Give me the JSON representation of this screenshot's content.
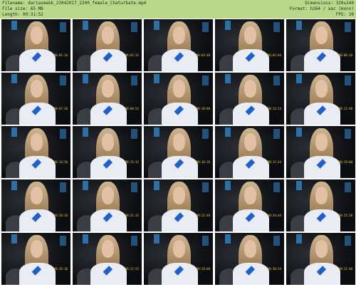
{
  "header": {
    "filename": "Filename: dariasmekk_23042017_2200_female_Chaturbate.mp4",
    "filesize": "File size: 65 MB",
    "length": "Length: 00:31:52",
    "dimensions": "Dimensions: 320x240",
    "format": "Format: h264 / aac (mono)",
    "fps": "FPS: 30"
  },
  "header_color": "#b9d98a",
  "thumbnails": [
    {
      "ts": "00:01:16"
    },
    {
      "ts": "00:02:32"
    },
    {
      "ts": "00:03:48"
    },
    {
      "ts": "00:05:04"
    },
    {
      "ts": "00:06:20"
    },
    {
      "ts": "00:07:36"
    },
    {
      "ts": "00:08:52"
    },
    {
      "ts": "00:10:08"
    },
    {
      "ts": "00:11:24"
    },
    {
      "ts": "00:12:40"
    },
    {
      "ts": "00:13:56"
    },
    {
      "ts": "00:15:12"
    },
    {
      "ts": "00:16:28"
    },
    {
      "ts": "00:17:44"
    },
    {
      "ts": "00:19:00"
    },
    {
      "ts": "00:20:16"
    },
    {
      "ts": "00:21:32"
    },
    {
      "ts": "00:22:48"
    },
    {
      "ts": "00:24:04"
    },
    {
      "ts": "00:25:20"
    },
    {
      "ts": "00:26:36"
    },
    {
      "ts": "00:27:52"
    },
    {
      "ts": "00:29:08"
    },
    {
      "ts": "00:30:24"
    },
    {
      "ts": "00:31:40"
    }
  ]
}
